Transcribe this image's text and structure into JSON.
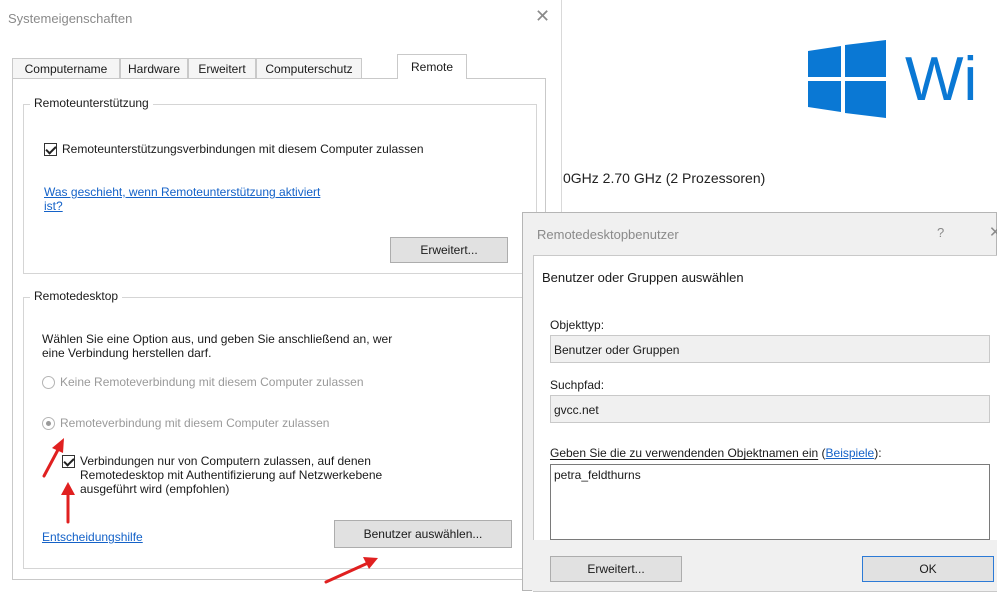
{
  "system_dialog": {
    "title": "Systemeigenschaften",
    "close_glyph": "✕",
    "tabs": [
      {
        "label": "Computername"
      },
      {
        "label": "Hardware"
      },
      {
        "label": "Erweitert"
      },
      {
        "label": "Computerschutz"
      },
      {
        "label": "Remote"
      }
    ],
    "active_tab": "Remote",
    "remote_assistance": {
      "group_title": "Remoteunterstützung",
      "checkbox_label": "Remoteunterstützungsverbindungen mit diesem Computer zulassen",
      "checkbox_checked": true,
      "help_link_line1": "Was geschieht, wenn Remoteunterstützung aktiviert",
      "help_link_line2": "ist?",
      "advanced_button": "Erweitert..."
    },
    "remote_desktop": {
      "group_title": "Remotedesktop",
      "description_line1": "Wählen Sie eine Option aus, und geben Sie anschließend an, wer",
      "description_line2": "eine Verbindung herstellen darf.",
      "option_none": "Keine Remoteverbindung mit diesem Computer zulassen",
      "option_allow": "Remoteverbindung mit diesem Computer zulassen",
      "option_allow_selected": true,
      "nla_line1": "Verbindungen nur von Computern zulassen, auf denen",
      "nla_line2": "Remotedesktop mit Authentifizierung auf Netzwerkebene",
      "nla_line3": "ausgeführt wird (empfohlen)",
      "nla_checked": true,
      "decision_link": "Entscheidungshilfe",
      "select_users_button": "Benutzer auswählen..."
    }
  },
  "background_window": {
    "windows_text": "Wi",
    "cpu_text": "0GHz   2.70 GHz  (2 Prozessoren)",
    "logo_color": "#0a78d4"
  },
  "rd_users_dialog": {
    "title": "Remotedesktopbenutzer",
    "help_glyph": "?",
    "close_glyph": "✕",
    "heading": "Benutzer oder Gruppen auswählen",
    "object_type_label": "Objekttyp:",
    "object_type_value": "Benutzer oder Gruppen",
    "search_path_label": "Suchpfad:",
    "search_path_value": "gvcc.net",
    "object_names_label": "Geben Sie die zu verwendenden Objektnamen ein",
    "examples_link": "Beispiele",
    "object_names_value": "petra_feldthurns",
    "advanced_button": "Erweitert...",
    "ok_button": "OK"
  },
  "annotation_color": "#e02020"
}
